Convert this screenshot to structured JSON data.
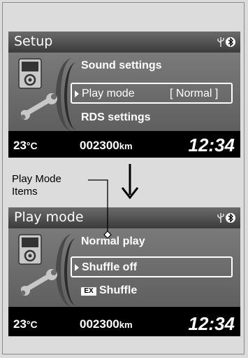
{
  "top_screen": {
    "title": "Setup",
    "menu_items": [
      "Sound settings",
      "RDS settings"
    ],
    "selected_item": {
      "label": "Play mode",
      "value": "[ Normal ]"
    }
  },
  "bottom_screen": {
    "title": "Play mode",
    "menu_items": [
      "Normal play",
      "Shuffle"
    ],
    "selected_item": {
      "label": "Shuffle off"
    },
    "shuffle_icon_text": "EX"
  },
  "status": {
    "temperature": "23",
    "temperature_unit": "°C",
    "odometer": "002300",
    "odometer_unit": "km",
    "clock": "12:34"
  },
  "callout": {
    "line1": "Play Mode",
    "line2": "Items"
  },
  "icons": [
    "usb-icon",
    "bluetooth-icon",
    "audio-device-icon",
    "wrench-icon",
    "arrow-down-icon",
    "shuffle-icon"
  ],
  "colors": {
    "screen_bg": "#000000",
    "panel_gradient_top": "#7a7a7a",
    "panel_gradient_bottom": "#5f5f5f",
    "text": "#ffffff",
    "page_bg": "#dcdcdc"
  }
}
